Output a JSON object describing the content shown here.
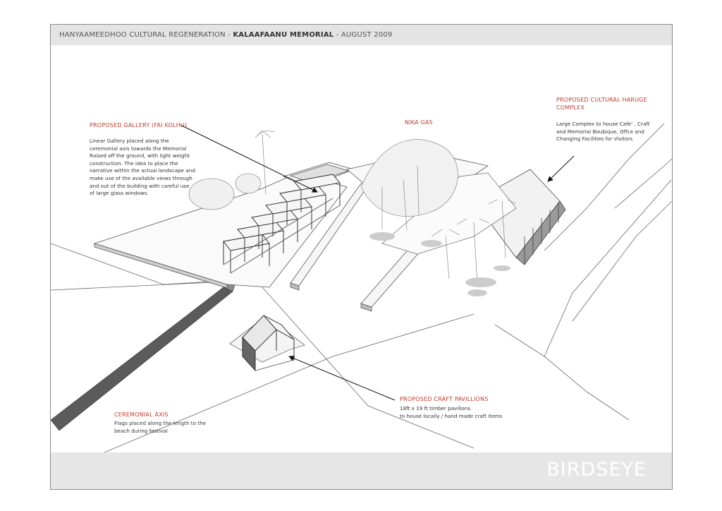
{
  "header": {
    "prefix": "HANYAAMEEDHOO CULTURAL REGENERATION - ",
    "project": "KALAAFAANU MEMORIAL",
    "suffix": " - AUGUST 2009"
  },
  "footer": {
    "title": "BIRDSEYE"
  },
  "annotations": {
    "gallery": {
      "title": "PROPOSED GALLERY (FAI KOLHU)",
      "lines": [
        "Linear Gallery placed along the",
        "ceremonial axis towards the Memorial",
        "Raised off the ground, with light weight",
        "construction. The idea to place the",
        "narrative within the actual landscape and",
        "make use of the available views through",
        "and out of the building with careful use",
        "of large glass windows."
      ]
    },
    "nika": {
      "title": "NIKA GAS"
    },
    "haruge": {
      "title_line1": "PROPOSED CULTURAL HARUGE",
      "title_line2": "COMPLEX",
      "lines": [
        "Large Complex to house Cafe' , Craft",
        "and Memorial Boubique, Offce and",
        "Changing Facilities for Visitors"
      ]
    },
    "pavillions": {
      "title": "PROPOSED CRAFT PAVILLIONS",
      "lines": [
        "18ft x 19 ft timber pavilions",
        "to house locally / hand made craft items"
      ]
    },
    "axis": {
      "title": "CEREMONIAL AXIS",
      "lines": [
        "Flags placed along the length to the",
        "beach during festival"
      ]
    }
  },
  "colors": {
    "accent": "#c0392b",
    "text": "#333333",
    "band": "#e4e4e4",
    "line": "#555555"
  }
}
